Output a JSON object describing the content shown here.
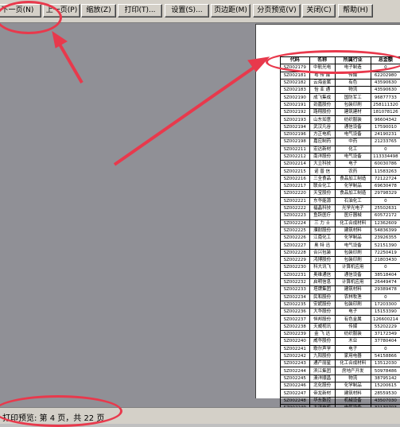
{
  "toolbar": {
    "buttons": [
      {
        "label": "下一页(N)",
        "name": "next-page-button"
      },
      {
        "label": "上一页(P)",
        "name": "previous-page-button"
      },
      {
        "label": "缩放(Z)",
        "name": "zoom-button"
      },
      {
        "label": "打印(T)...",
        "name": "print-button"
      },
      {
        "label": "设置(S)...",
        "name": "setup-button"
      },
      {
        "label": "页边距(M)",
        "name": "margins-button"
      },
      {
        "label": "分页预览(V)",
        "name": "page-break-preview-button"
      },
      {
        "label": "关闭(C)",
        "name": "close-button"
      },
      {
        "label": "帮助(H)",
        "name": "help-button"
      }
    ]
  },
  "status": {
    "text": "打印预览: 第 4 页，共 22 页"
  },
  "sheet": {
    "headers": [
      "代码",
      "名称",
      "所属行业",
      "总金额"
    ],
    "rows": [
      [
        "SZ002179",
        "中航光电",
        "电子制造",
        "0"
      ],
      [
        "SZ002181",
        "粤 传 媒",
        "传媒",
        "62202980"
      ],
      [
        "SZ002182",
        "云海金属",
        "有色",
        "43590630"
      ],
      [
        "SZ002183",
        "怡 亚 通",
        "物流",
        "43590630"
      ],
      [
        "SZ002190",
        "成飞集成",
        "国防军工",
        "96877733"
      ],
      [
        "SZ002191",
        "劲嘉股份",
        "包装印刷",
        "258111320"
      ],
      [
        "SZ002192",
        "路翔股份",
        "建筑建材",
        "181078126"
      ],
      [
        "SZ002193",
        "山东如意",
        "纺织服装",
        "96604342"
      ],
      [
        "SZ002194",
        "武汉凡谷",
        "通信设备",
        "17590010"
      ],
      [
        "SZ002196",
        "方正电机",
        "电气设备",
        "24190231"
      ],
      [
        "SZ002198",
        "嘉应制药",
        "中药",
        "21233765"
      ],
      [
        "SZ002211",
        "宏达新材",
        "化工",
        "0"
      ],
      [
        "SZ002212",
        "南洋股份",
        "电气设备",
        "113334498"
      ],
      [
        "SZ002214",
        "大立科技",
        "电子",
        "60030786"
      ],
      [
        "SZ002215",
        "诺 普 信",
        "农药",
        "11583263"
      ],
      [
        "SZ002216",
        "三全食品",
        "食品加工制造",
        "72122724"
      ],
      [
        "SZ002217",
        "联合化工",
        "化学制品",
        "69630478"
      ],
      [
        "SZ002220",
        "天宝股份",
        "食品加工制造",
        "29798329"
      ],
      [
        "SZ002221",
        "东华能源",
        "石油化工",
        "0"
      ],
      [
        "SZ002222",
        "福晶科技",
        "光学光电子",
        "25502631"
      ],
      [
        "SZ002223",
        "鱼跃医疗",
        "医疗器械",
        "60572172"
      ],
      [
        "SZ002224",
        "三 力 士",
        "化工合成材料",
        "12362609"
      ],
      [
        "SZ002225",
        "濮耐股份",
        "建筑材料",
        "54836399"
      ],
      [
        "SZ002226",
        "江南化工",
        "化学制品",
        "23926355"
      ],
      [
        "SZ002227",
        "奥 特 迅",
        "电气设备",
        "52151390"
      ],
      [
        "SZ002228",
        "合兴包装",
        "包装印刷",
        "72250419"
      ],
      [
        "SZ002229",
        "鸿博股份",
        "包装印刷",
        "21803430"
      ],
      [
        "SZ002230",
        "科大讯飞",
        "计算机应用",
        "0"
      ],
      [
        "SZ002231",
        "奥维通信",
        "通信设备",
        "38518404"
      ],
      [
        "SZ002232",
        "启明信息",
        "计算机应用",
        "26449474"
      ],
      [
        "SZ002233",
        "塔牌集团",
        "建筑材料",
        "29389478"
      ],
      [
        "SZ002234",
        "民和股份",
        "农林牧渔",
        "0"
      ],
      [
        "SZ002235",
        "安妮股份",
        "包装印刷",
        "17203300"
      ],
      [
        "SZ002236",
        "大华股份",
        "电子",
        "15153390"
      ],
      [
        "SZ002237",
        "恒邦股份",
        "有色金属",
        "126600214"
      ],
      [
        "SZ002238",
        "天威视讯",
        "传媒",
        "55202229"
      ],
      [
        "SZ002239",
        "金 飞 达",
        "纺织服装",
        "37172349"
      ],
      [
        "SZ002240",
        "威华股份",
        "木业",
        "37780404"
      ],
      [
        "SZ002241",
        "歌尔声学",
        "电子",
        "0"
      ],
      [
        "SZ002242",
        "九阳股份",
        "家用电器",
        "54158866"
      ],
      [
        "SZ002243",
        "通产丽星",
        "化工合成材料",
        "13512030"
      ],
      [
        "SZ002244",
        "滨江集团",
        "房地产开发",
        "50978486"
      ],
      [
        "SZ002245",
        "澳洋顺昌",
        "物流",
        "38795142"
      ],
      [
        "SZ002246",
        "北化股份",
        "化学制品",
        "15200615"
      ],
      [
        "SZ002247",
        "帝龙新材",
        "建筑材料",
        "28559530"
      ],
      [
        "SZ002248",
        "华东数控",
        "机械设备",
        "43507030"
      ],
      [
        "SZ002249",
        "大洋电机",
        "电气设备",
        "31130703"
      ],
      [
        "SZ002250",
        "联化科技",
        "化学制品",
        "29957047"
      ]
    ]
  },
  "colors": {
    "annotation": "#e8394c",
    "workspace": "#909096",
    "chrome": "#d4d0c8"
  }
}
